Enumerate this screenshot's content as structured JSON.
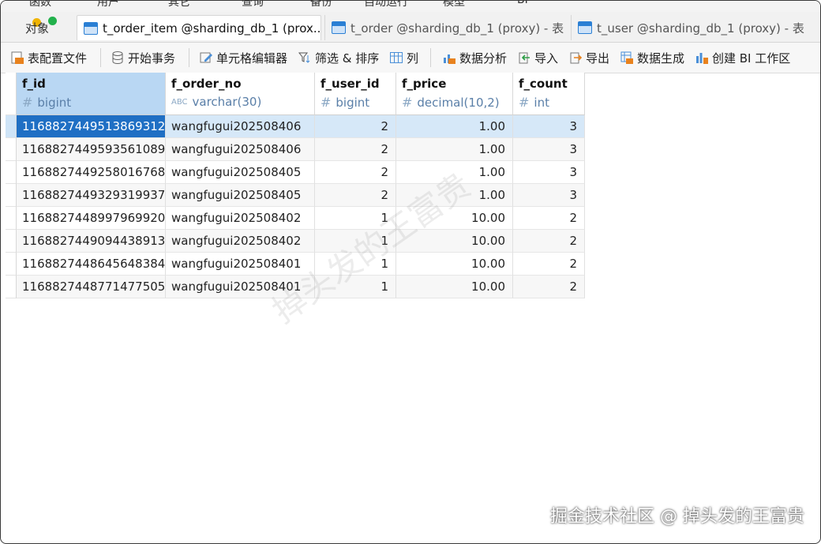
{
  "menu": [
    "函数",
    "用户",
    "其它",
    "查询",
    "备份",
    "自动运行",
    "模型",
    "BI"
  ],
  "tabs": {
    "objects": "对象",
    "active": "t_order_item @sharding_db_1 (prox...",
    "t2": "t_order @sharding_db_1 (proxy) - 表",
    "t3": "t_user @sharding_db_1 (proxy) - 表"
  },
  "toolbar": {
    "config_file": "表配置文件",
    "begin_tx": "开始事务",
    "cell_editor": "单元格编辑器",
    "filter_sort": "筛选 & 排序",
    "columns": "列",
    "data_analysis": "数据分析",
    "import": "导入",
    "export": "导出",
    "data_gen": "数据生成",
    "create_bi": "创建 BI 工作区"
  },
  "columns": [
    {
      "name": "f_id",
      "type": "bigint",
      "type_icon": "#"
    },
    {
      "name": "f_order_no",
      "type": "varchar(30)",
      "type_icon": "ABC"
    },
    {
      "name": "f_user_id",
      "type": "bigint",
      "type_icon": "#"
    },
    {
      "name": "f_price",
      "type": "decimal(10,2)",
      "type_icon": "#"
    },
    {
      "name": "f_count",
      "type": "int",
      "type_icon": "#"
    }
  ],
  "rows": [
    [
      "1168827449513869312",
      "wangfugui202508406",
      "2",
      "1.00",
      "3"
    ],
    [
      "1168827449593561089",
      "wangfugui202508406",
      "2",
      "1.00",
      "3"
    ],
    [
      "1168827449258016768",
      "wangfugui202508405",
      "2",
      "1.00",
      "3"
    ],
    [
      "1168827449329319937",
      "wangfugui202508405",
      "2",
      "1.00",
      "3"
    ],
    [
      "1168827448997969920",
      "wangfugui202508402",
      "1",
      "10.00",
      "2"
    ],
    [
      "1168827449094438913",
      "wangfugui202508402",
      "1",
      "10.00",
      "2"
    ],
    [
      "1168827448645648384",
      "wangfugui202508401",
      "1",
      "10.00",
      "2"
    ],
    [
      "1168827448771477505",
      "wangfugui202508401",
      "1",
      "10.00",
      "2"
    ]
  ],
  "watermark": "掉头发的王富贵",
  "footer": "掘金技术社区 @ 掉头发的王富贵",
  "colors": {
    "accent": "#1f6fc4",
    "selected_row": "#d6e8f8",
    "header_selected": "#b9d7f3"
  }
}
